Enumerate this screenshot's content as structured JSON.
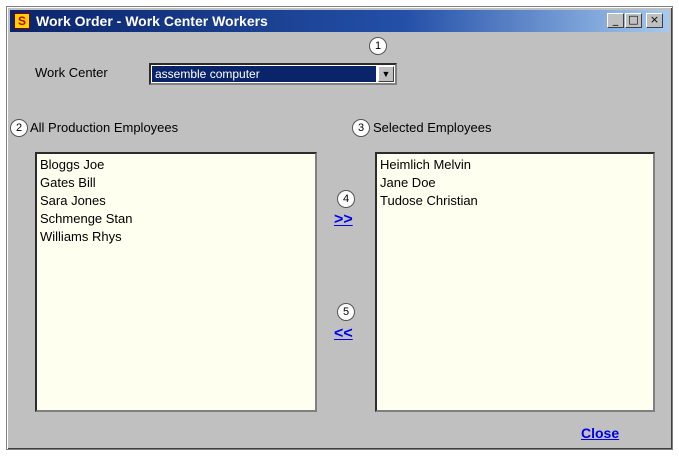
{
  "window": {
    "title": "Work Order - Work Center Workers",
    "app_icon_glyph": "S",
    "controls": {
      "minimize": "_",
      "maximize": "□",
      "close": "×"
    }
  },
  "work_center": {
    "label": "Work Center",
    "selected": "assemble computer",
    "callout": "1",
    "dropdown_glyph": "▼"
  },
  "all_employees": {
    "label": "All Production Employees",
    "callout": "2",
    "items": [
      "Bloggs Joe",
      "Gates Bill",
      "Sara Jones",
      "Schmenge Stan",
      "Williams Rhys"
    ]
  },
  "selected_employees": {
    "label": "Selected  Employees",
    "callout": "3",
    "items": [
      "Heimlich Melvin",
      "Jane Doe",
      "Tudose Christian"
    ]
  },
  "add_button": {
    "label": ">>",
    "callout": "4"
  },
  "remove_button": {
    "label": "<<",
    "callout": "5"
  },
  "close_label": "Close",
  "colors": {
    "title_bar": "#0a246a",
    "list_background": "#fffff0",
    "link": "#0000ee"
  }
}
